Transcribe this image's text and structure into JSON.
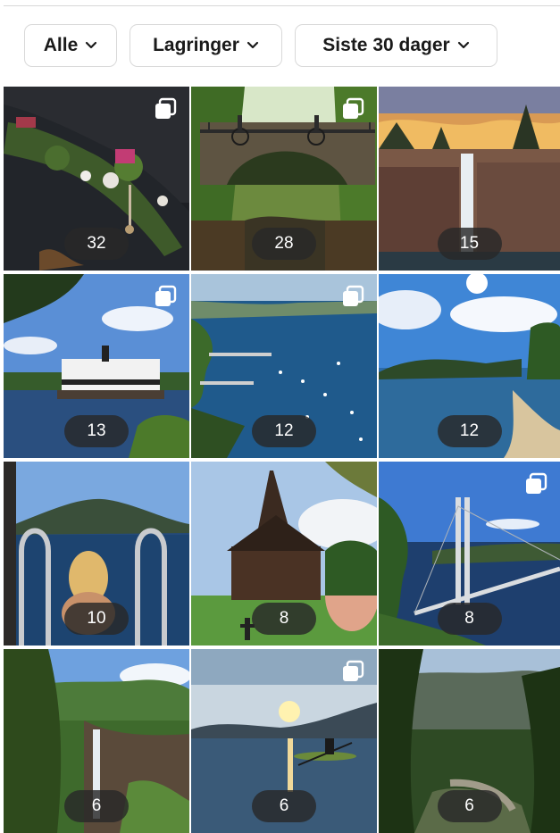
{
  "filters": {
    "all": {
      "label": "Alle",
      "icon": "chevron-down-icon"
    },
    "saves": {
      "label": "Lagringer",
      "icon": "chevron-down-icon"
    },
    "period": {
      "label": "Siste 30 dager",
      "icon": "chevron-down-icon"
    }
  },
  "posts": [
    {
      "count": "32",
      "multi": true,
      "subject": "island-with-houses"
    },
    {
      "count": "28",
      "multi": true,
      "subject": "stone-bridge"
    },
    {
      "count": "15",
      "multi": false,
      "subject": "waterfall-sunset"
    },
    {
      "count": "13",
      "multi": true,
      "subject": "steamboat-lake"
    },
    {
      "count": "12",
      "multi": true,
      "subject": "harbor-aerial"
    },
    {
      "count": "12",
      "multi": false,
      "subject": "lake-beach"
    },
    {
      "count": "10",
      "multi": false,
      "subject": "woman-swim-ladder"
    },
    {
      "count": "8",
      "multi": false,
      "subject": "stave-church"
    },
    {
      "count": "8",
      "multi": true,
      "subject": "suspension-bridge"
    },
    {
      "count": "6",
      "multi": false,
      "subject": "valley-waterfall"
    },
    {
      "count": "6",
      "multi": true,
      "subject": "kayak-sunset"
    },
    {
      "count": "6",
      "multi": false,
      "subject": "forest-road"
    }
  ],
  "colors": {
    "chip_border": "#d9d9d9",
    "badge_bg": "#282828",
    "badge_text": "#ffffff"
  }
}
